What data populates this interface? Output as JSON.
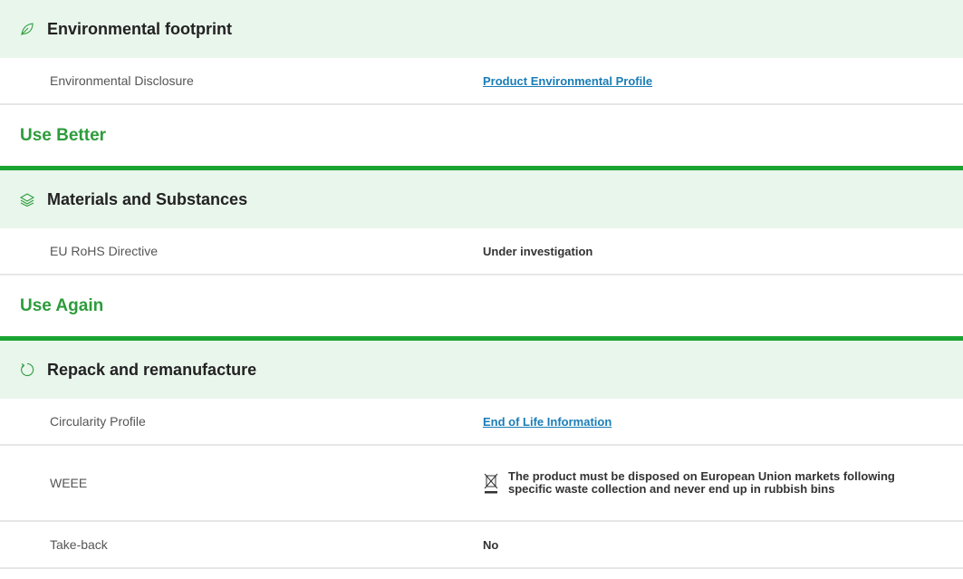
{
  "sections": {
    "environmental_footprint": {
      "title": "Environmental footprint",
      "icon": "leaf-icon",
      "rows": [
        {
          "label": "Environmental Disclosure",
          "value": "Product Environmental Profile"
        }
      ]
    },
    "use_better": {
      "title": "Use Better"
    },
    "materials": {
      "title": "Materials and Substances",
      "icon": "layers-icon",
      "rows": [
        {
          "label": "EU RoHS Directive",
          "value": "Under investigation"
        }
      ]
    },
    "use_again": {
      "title": "Use Again"
    },
    "repack": {
      "title": "Repack and remanufacture",
      "icon": "refresh-icon",
      "rows": [
        {
          "label": "Circularity Profile",
          "value": "End of Life Information"
        },
        {
          "label": "WEEE",
          "value": "The product must be disposed on European Union markets following specific waste collection and never end up in rubbish bins",
          "icon": "crossed-bin-icon"
        },
        {
          "label": "Take-back",
          "value": "No"
        }
      ]
    }
  },
  "colors": {
    "header_bg": "#e9f6ec",
    "accent_green": "#1aa431",
    "category_text": "#2d9c3c",
    "link": "#1a7db7"
  }
}
